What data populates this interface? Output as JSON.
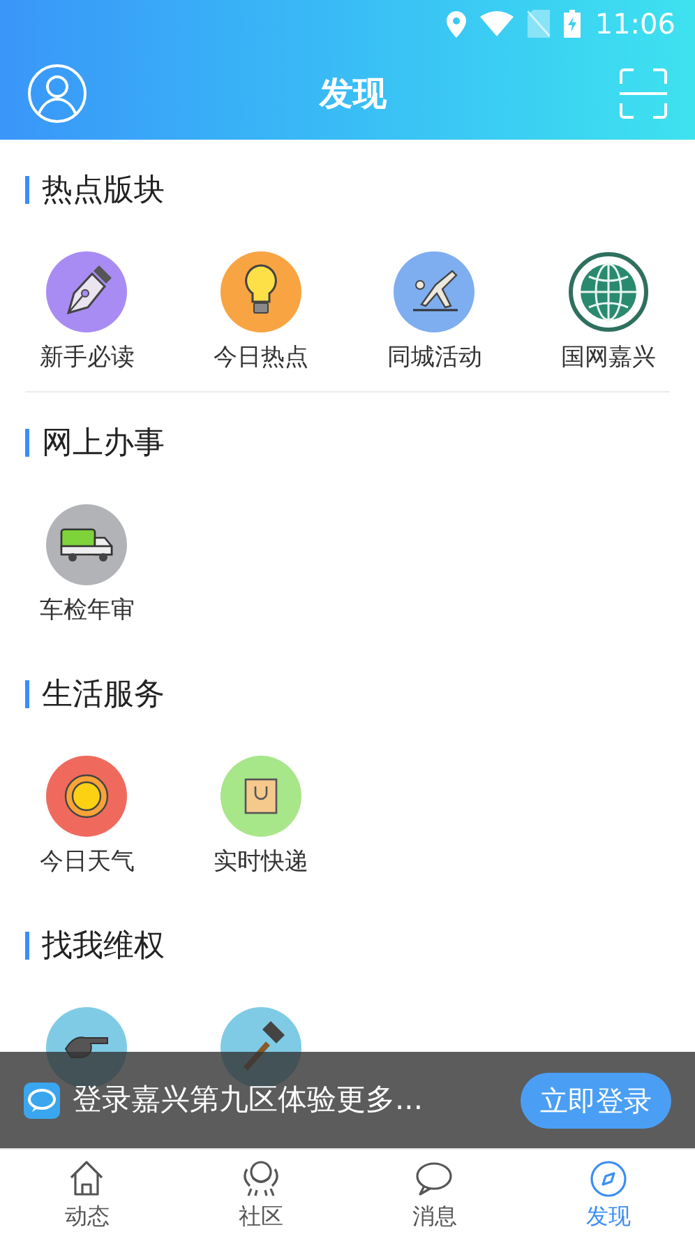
{
  "status_bar": {
    "time": "11:06"
  },
  "header": {
    "title": "发现"
  },
  "sections": [
    {
      "title": "热点版块",
      "divider": true,
      "items": [
        {
          "label": "新手必读",
          "kind": "pen"
        },
        {
          "label": "今日热点",
          "kind": "bulb"
        },
        {
          "label": "同城活动",
          "kind": "gymnast"
        },
        {
          "label": "国网嘉兴",
          "kind": "globe"
        }
      ]
    },
    {
      "title": "网上办事",
      "divider": false,
      "items": [
        {
          "label": "车检年审",
          "kind": "truck"
        }
      ]
    },
    {
      "title": "生活服务",
      "divider": false,
      "items": [
        {
          "label": "今日天气",
          "kind": "sun"
        },
        {
          "label": "实时快递",
          "kind": "bag"
        }
      ]
    },
    {
      "title": "找我维权",
      "divider": false,
      "items": [
        {
          "kind": "hand"
        },
        {
          "kind": "hammer"
        }
      ]
    }
  ],
  "login_banner": {
    "text": "登录嘉兴第九区体验更多...",
    "button": "立即登录"
  },
  "tab_bar": [
    {
      "label": "动态",
      "kind": "home",
      "selected": false
    },
    {
      "label": "社区",
      "kind": "community",
      "selected": false
    },
    {
      "label": "消息",
      "kind": "message",
      "selected": false
    },
    {
      "label": "发现",
      "kind": "discover",
      "selected": true
    }
  ]
}
